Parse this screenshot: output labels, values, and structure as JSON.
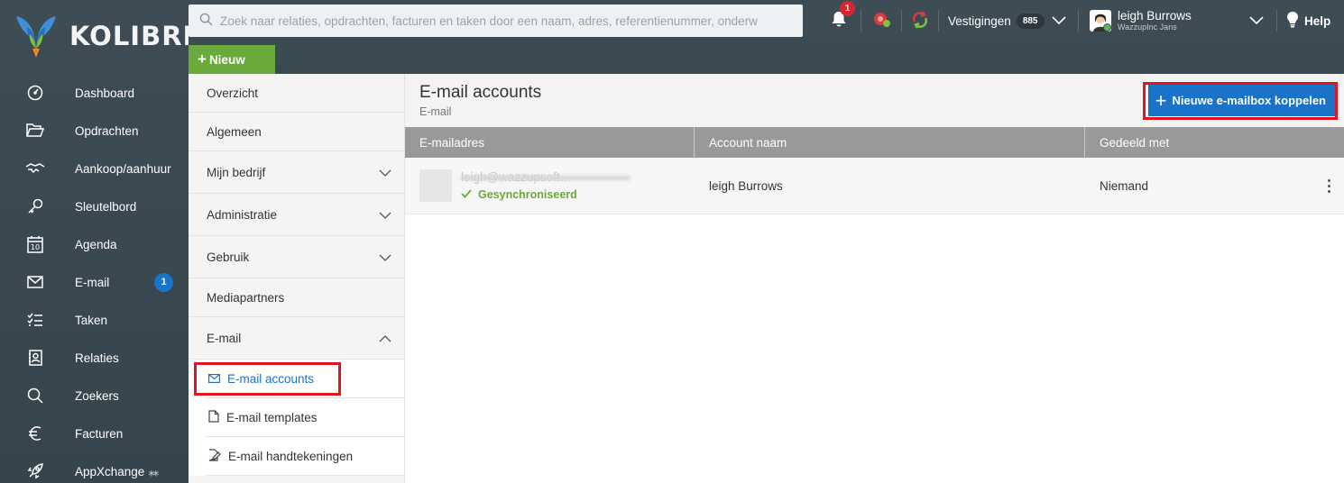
{
  "brand": {
    "name": "KOLIBRI"
  },
  "sidebar": {
    "items": [
      {
        "label": "Dashboard",
        "icon": "dashboard-icon"
      },
      {
        "label": "Opdrachten",
        "icon": "folder-icon"
      },
      {
        "label": "Aankoop/aanhuur",
        "icon": "handshake-icon"
      },
      {
        "label": "Sleutelbord",
        "icon": "key-icon"
      },
      {
        "label": "Agenda",
        "icon": "calendar-icon",
        "day": "10"
      },
      {
        "label": "E-mail",
        "icon": "mail-icon",
        "badge": "1"
      },
      {
        "label": "Taken",
        "icon": "tasks-icon"
      },
      {
        "label": "Relaties",
        "icon": "contacts-icon"
      },
      {
        "label": "Zoekers",
        "icon": "search-icon"
      },
      {
        "label": "Facturen",
        "icon": "euro-icon"
      },
      {
        "label": "AppXchange",
        "icon": "rocket-icon",
        "extra": "⁎⁎"
      }
    ]
  },
  "topbar": {
    "search_placeholder": "Zoek naar relaties, opdrachten, facturen en taken door een naam, adres, referentienummer, onderw",
    "new_label": "Nieuw",
    "notifications_badge": "1",
    "branches_label": "Vestigingen",
    "branches_count": "885",
    "user_name": "leigh Burrows",
    "user_org": "WazzupInc Jans",
    "help_label": "Help"
  },
  "subnav": {
    "items": [
      {
        "label": "Overzicht"
      },
      {
        "label": "Algemeen"
      },
      {
        "label": "Mijn bedrijf",
        "expandable": true
      },
      {
        "label": "Administratie",
        "expandable": true
      },
      {
        "label": "Gebruik",
        "expandable": true
      },
      {
        "label": "Mediapartners"
      },
      {
        "label": "E-mail",
        "expanded": true
      }
    ],
    "email_children": [
      {
        "label": "E-mail accounts",
        "icon": "mail-icon",
        "active": true
      },
      {
        "label": "E-mail templates",
        "icon": "document-icon"
      },
      {
        "label": "E-mail handtekeningen",
        "icon": "signature-icon"
      }
    ]
  },
  "main": {
    "title": "E-mail accounts",
    "subtitle": "E-mail",
    "add_button": "Nieuwe e-mailbox koppelen",
    "columns": [
      "E-mailadres",
      "Account naam",
      "Gedeeld met"
    ],
    "rows": [
      {
        "email": "leigh@wazzupsoft…",
        "status": "Gesynchroniseerd",
        "account": "leigh Burrows",
        "shared": "Niemand"
      }
    ]
  },
  "colors": {
    "sidebar_bg": "#3e4c55",
    "accent_blue": "#1a73c8",
    "accent_green": "#6aaa3a",
    "highlight_red": "#e0161e"
  }
}
